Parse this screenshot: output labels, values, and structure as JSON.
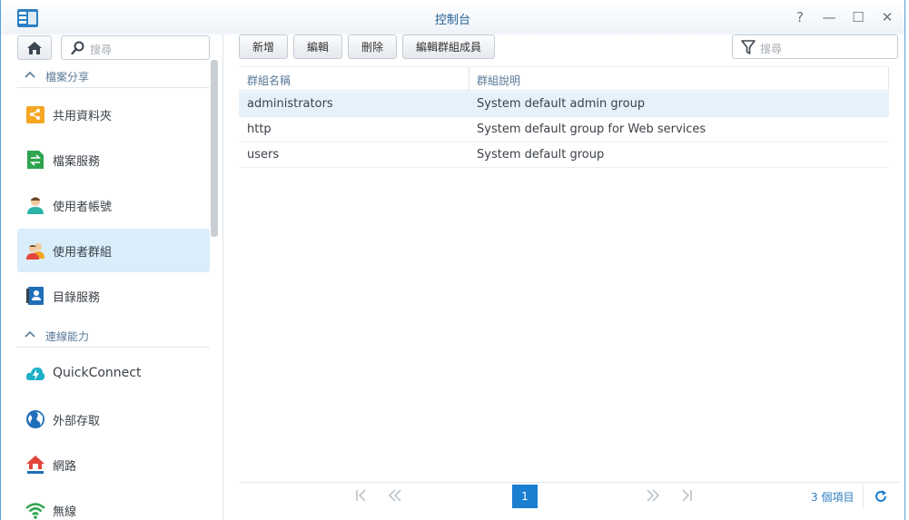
{
  "window": {
    "title": "控制台",
    "controls": {
      "help": "?",
      "minimize": "—",
      "maximize": "☐",
      "close": "✕"
    }
  },
  "sidebar": {
    "search_placeholder": "搜尋",
    "sections": [
      {
        "header": "檔案分享",
        "items": [
          {
            "label": "共用資料夾",
            "icon": "shared-folder-icon",
            "active": false
          },
          {
            "label": "檔案服務",
            "icon": "file-services-icon",
            "active": false
          },
          {
            "label": "使用者帳號",
            "icon": "user-icon",
            "active": false
          },
          {
            "label": "使用者群組",
            "icon": "group-icon",
            "active": true
          },
          {
            "label": "目錄服務",
            "icon": "directory-icon",
            "active": false
          }
        ]
      },
      {
        "header": "連線能力",
        "items": [
          {
            "label": "QuickConnect",
            "icon": "quickconnect-icon",
            "active": false
          },
          {
            "label": "外部存取",
            "icon": "external-access-icon",
            "active": false
          },
          {
            "label": "網路",
            "icon": "network-icon",
            "active": false
          },
          {
            "label": "無線",
            "icon": "wireless-icon",
            "active": false
          }
        ]
      }
    ]
  },
  "toolbar": {
    "create": "新增",
    "edit": "編輯",
    "delete": "刪除",
    "edit_members": "編輯群組成員",
    "filter_placeholder": "搜尋"
  },
  "grid": {
    "columns": [
      "群組名稱",
      "群組說明"
    ],
    "rows": [
      {
        "name": "administrators",
        "description": "System default admin group",
        "selected": true
      },
      {
        "name": "http",
        "description": "System default group for Web services",
        "selected": false
      },
      {
        "name": "users",
        "description": "System default group",
        "selected": false
      }
    ]
  },
  "pager": {
    "current_page": "1",
    "total": "3 個項目"
  },
  "colors": {
    "accent": "#1a7ed1",
    "selected_row": "#e5f2fb",
    "active_nav": "#d9edfa",
    "title_text": "#1f5f94"
  }
}
